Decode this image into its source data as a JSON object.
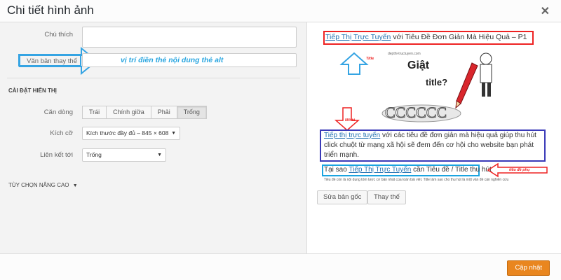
{
  "modal": {
    "title": "Chi tiết hình ảnh",
    "close_icon": "close-icon"
  },
  "form": {
    "caption_label": "Chú thích",
    "caption_value": "",
    "alt_label": "Văn bản thay thế",
    "alt_value": "vị trí điền thẻ nội dung thẻ alt",
    "display_heading": "CÀI ĐẶT HIỂN THỊ",
    "align_label": "Căn dòng",
    "align_options": [
      "Trái",
      "Chính giữa",
      "Phải",
      "Trống"
    ],
    "align_selected": "Trống",
    "size_label": "Kích cỡ",
    "size_value": "Kích thước đầy đủ – 845 × 608",
    "link_label": "Liên kết tới",
    "link_value": "Trống",
    "advanced_label": "TÙY CHỌN NÂNG CAO"
  },
  "preview": {
    "title_link": "Tiếp Thị Trực Tuyến",
    "title_rest": " với Tiêu Đề Đơn Giản Mà Hiệu Quả – P1",
    "site_label": "depthi-tructuyen.com",
    "image_word1": "Giật",
    "image_word2": "title?",
    "tag_title": "Title",
    "tag_desc": "Mô tả",
    "tag_caption": "tiêu đề phụ",
    "desc_link": "Tiếp thị trực tuyến",
    "desc_rest": " với các tiêu đề đơn giản mà hiệu quả giúp thu hút click chuột từ mạng xã hội sẽ đem đến cơ hội cho website bạn phát triển mạnh.",
    "caption_prefix": "Tại sao ",
    "caption_link": "Tiếp Thị Trực Tuyến",
    "caption_rest": " cần Tiêu đề / Title thu hút",
    "small_note": "Tiêu đề còn là nội dung tóm lược cơ bản nhất của toàn bài viết. Title làm sao cho thu hút là một vấn đề cần nghiên cứu",
    "edit_original_label": "Sửa bản gốc",
    "replace_label": "Thay thế"
  },
  "footer": {
    "update_label": "Cập nhật"
  },
  "colors": {
    "accent_blue": "#35a4e3",
    "red_box": "#e22222",
    "navy_box": "#3a3ab8",
    "update_orange": "#e9861f"
  }
}
